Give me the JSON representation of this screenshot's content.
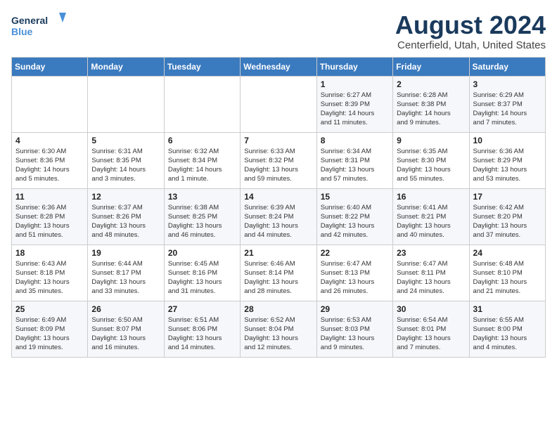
{
  "header": {
    "logo_line1": "General",
    "logo_line2": "Blue",
    "title": "August 2024",
    "subtitle": "Centerfield, Utah, United States"
  },
  "weekdays": [
    "Sunday",
    "Monday",
    "Tuesday",
    "Wednesday",
    "Thursday",
    "Friday",
    "Saturday"
  ],
  "weeks": [
    [
      {
        "day": "",
        "info": ""
      },
      {
        "day": "",
        "info": ""
      },
      {
        "day": "",
        "info": ""
      },
      {
        "day": "",
        "info": ""
      },
      {
        "day": "1",
        "info": "Sunrise: 6:27 AM\nSunset: 8:39 PM\nDaylight: 14 hours\nand 11 minutes."
      },
      {
        "day": "2",
        "info": "Sunrise: 6:28 AM\nSunset: 8:38 PM\nDaylight: 14 hours\nand 9 minutes."
      },
      {
        "day": "3",
        "info": "Sunrise: 6:29 AM\nSunset: 8:37 PM\nDaylight: 14 hours\nand 7 minutes."
      }
    ],
    [
      {
        "day": "4",
        "info": "Sunrise: 6:30 AM\nSunset: 8:36 PM\nDaylight: 14 hours\nand 5 minutes."
      },
      {
        "day": "5",
        "info": "Sunrise: 6:31 AM\nSunset: 8:35 PM\nDaylight: 14 hours\nand 3 minutes."
      },
      {
        "day": "6",
        "info": "Sunrise: 6:32 AM\nSunset: 8:34 PM\nDaylight: 14 hours\nand 1 minute."
      },
      {
        "day": "7",
        "info": "Sunrise: 6:33 AM\nSunset: 8:32 PM\nDaylight: 13 hours\nand 59 minutes."
      },
      {
        "day": "8",
        "info": "Sunrise: 6:34 AM\nSunset: 8:31 PM\nDaylight: 13 hours\nand 57 minutes."
      },
      {
        "day": "9",
        "info": "Sunrise: 6:35 AM\nSunset: 8:30 PM\nDaylight: 13 hours\nand 55 minutes."
      },
      {
        "day": "10",
        "info": "Sunrise: 6:36 AM\nSunset: 8:29 PM\nDaylight: 13 hours\nand 53 minutes."
      }
    ],
    [
      {
        "day": "11",
        "info": "Sunrise: 6:36 AM\nSunset: 8:28 PM\nDaylight: 13 hours\nand 51 minutes."
      },
      {
        "day": "12",
        "info": "Sunrise: 6:37 AM\nSunset: 8:26 PM\nDaylight: 13 hours\nand 48 minutes."
      },
      {
        "day": "13",
        "info": "Sunrise: 6:38 AM\nSunset: 8:25 PM\nDaylight: 13 hours\nand 46 minutes."
      },
      {
        "day": "14",
        "info": "Sunrise: 6:39 AM\nSunset: 8:24 PM\nDaylight: 13 hours\nand 44 minutes."
      },
      {
        "day": "15",
        "info": "Sunrise: 6:40 AM\nSunset: 8:22 PM\nDaylight: 13 hours\nand 42 minutes."
      },
      {
        "day": "16",
        "info": "Sunrise: 6:41 AM\nSunset: 8:21 PM\nDaylight: 13 hours\nand 40 minutes."
      },
      {
        "day": "17",
        "info": "Sunrise: 6:42 AM\nSunset: 8:20 PM\nDaylight: 13 hours\nand 37 minutes."
      }
    ],
    [
      {
        "day": "18",
        "info": "Sunrise: 6:43 AM\nSunset: 8:18 PM\nDaylight: 13 hours\nand 35 minutes."
      },
      {
        "day": "19",
        "info": "Sunrise: 6:44 AM\nSunset: 8:17 PM\nDaylight: 13 hours\nand 33 minutes."
      },
      {
        "day": "20",
        "info": "Sunrise: 6:45 AM\nSunset: 8:16 PM\nDaylight: 13 hours\nand 31 minutes."
      },
      {
        "day": "21",
        "info": "Sunrise: 6:46 AM\nSunset: 8:14 PM\nDaylight: 13 hours\nand 28 minutes."
      },
      {
        "day": "22",
        "info": "Sunrise: 6:47 AM\nSunset: 8:13 PM\nDaylight: 13 hours\nand 26 minutes."
      },
      {
        "day": "23",
        "info": "Sunrise: 6:47 AM\nSunset: 8:11 PM\nDaylight: 13 hours\nand 24 minutes."
      },
      {
        "day": "24",
        "info": "Sunrise: 6:48 AM\nSunset: 8:10 PM\nDaylight: 13 hours\nand 21 minutes."
      }
    ],
    [
      {
        "day": "25",
        "info": "Sunrise: 6:49 AM\nSunset: 8:09 PM\nDaylight: 13 hours\nand 19 minutes."
      },
      {
        "day": "26",
        "info": "Sunrise: 6:50 AM\nSunset: 8:07 PM\nDaylight: 13 hours\nand 16 minutes."
      },
      {
        "day": "27",
        "info": "Sunrise: 6:51 AM\nSunset: 8:06 PM\nDaylight: 13 hours\nand 14 minutes."
      },
      {
        "day": "28",
        "info": "Sunrise: 6:52 AM\nSunset: 8:04 PM\nDaylight: 13 hours\nand 12 minutes."
      },
      {
        "day": "29",
        "info": "Sunrise: 6:53 AM\nSunset: 8:03 PM\nDaylight: 13 hours\nand 9 minutes."
      },
      {
        "day": "30",
        "info": "Sunrise: 6:54 AM\nSunset: 8:01 PM\nDaylight: 13 hours\nand 7 minutes."
      },
      {
        "day": "31",
        "info": "Sunrise: 6:55 AM\nSunset: 8:00 PM\nDaylight: 13 hours\nand 4 minutes."
      }
    ]
  ]
}
